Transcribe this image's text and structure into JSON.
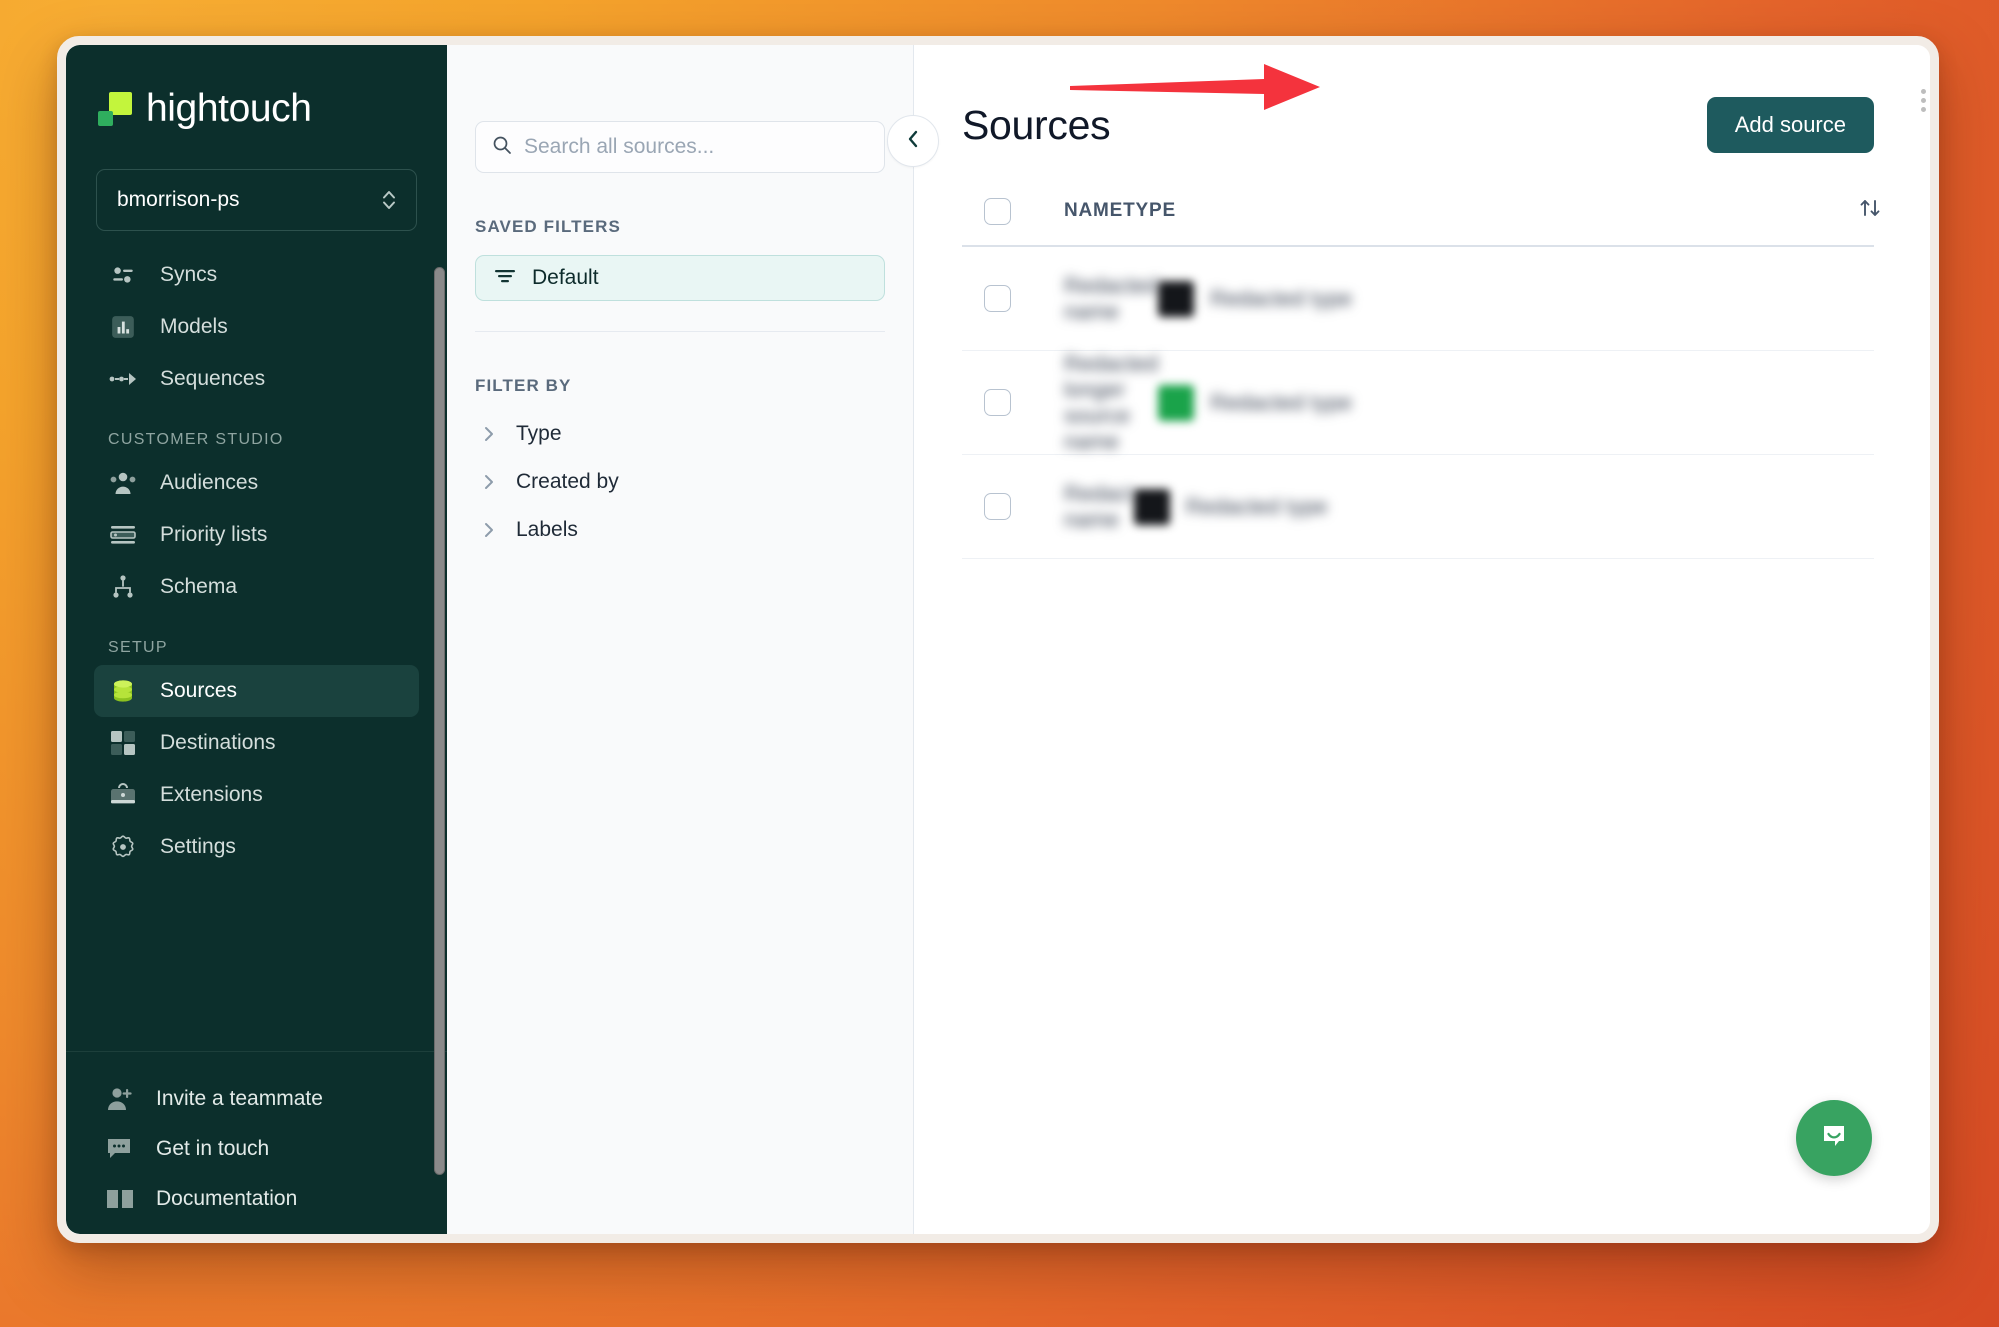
{
  "brand": {
    "logo_word": "hightouch",
    "accent_lime": "#c3f53c",
    "accent_green": "#2fae5e",
    "sidebar_bg": "#0c2f2c",
    "button_teal": "#1e5a5e",
    "annotation_red": "#f4333d"
  },
  "sidebar": {
    "workspace": "bmorrison-ps",
    "items": [
      {
        "label": "Syncs",
        "icon": "sliders-icon",
        "active": false
      },
      {
        "label": "Models",
        "icon": "bar-chart-icon",
        "active": false
      },
      {
        "label": "Sequences",
        "icon": "arrow-flow-icon",
        "active": false
      }
    ],
    "groups": [
      {
        "label": "CUSTOMER STUDIO",
        "items": [
          {
            "label": "Audiences",
            "icon": "people-icon",
            "active": false
          },
          {
            "label": "Priority lists",
            "icon": "list-icon",
            "active": false
          },
          {
            "label": "Schema",
            "icon": "hierarchy-icon",
            "active": false
          }
        ]
      },
      {
        "label": "SETUP",
        "items": [
          {
            "label": "Sources",
            "icon": "database-icon",
            "active": true
          },
          {
            "label": "Destinations",
            "icon": "grid-squares-icon",
            "active": false
          },
          {
            "label": "Extensions",
            "icon": "briefcase-icon",
            "active": false
          },
          {
            "label": "Settings",
            "icon": "gear-icon",
            "active": false
          }
        ]
      }
    ],
    "footer": [
      {
        "label": "Invite a teammate",
        "icon": "user-plus-icon"
      },
      {
        "label": "Get in touch",
        "icon": "chat-bubble-icon"
      },
      {
        "label": "Documentation",
        "icon": "book-icon"
      }
    ]
  },
  "filter_panel": {
    "search": {
      "value": "",
      "placeholder": "Search all sources..."
    },
    "saved_filters_heading": "SAVED FILTERS",
    "saved_filters": [
      {
        "label": "Default",
        "selected": true
      }
    ],
    "filter_by_heading": "FILTER BY",
    "filters": [
      {
        "label": "Type"
      },
      {
        "label": "Created by"
      },
      {
        "label": "Labels"
      }
    ],
    "collapse_button": "collapse-panel-button"
  },
  "main": {
    "title": "Sources",
    "add_button": "Add source",
    "table": {
      "columns": [
        "NAME",
        "TYPE"
      ],
      "rows": [
        {
          "name": "",
          "type": "",
          "redacted": true
        },
        {
          "name": "",
          "type": "",
          "redacted": true
        },
        {
          "name": "",
          "type": "",
          "redacted": true
        }
      ]
    }
  },
  "support": {
    "launcher": "intercom-launcher"
  }
}
